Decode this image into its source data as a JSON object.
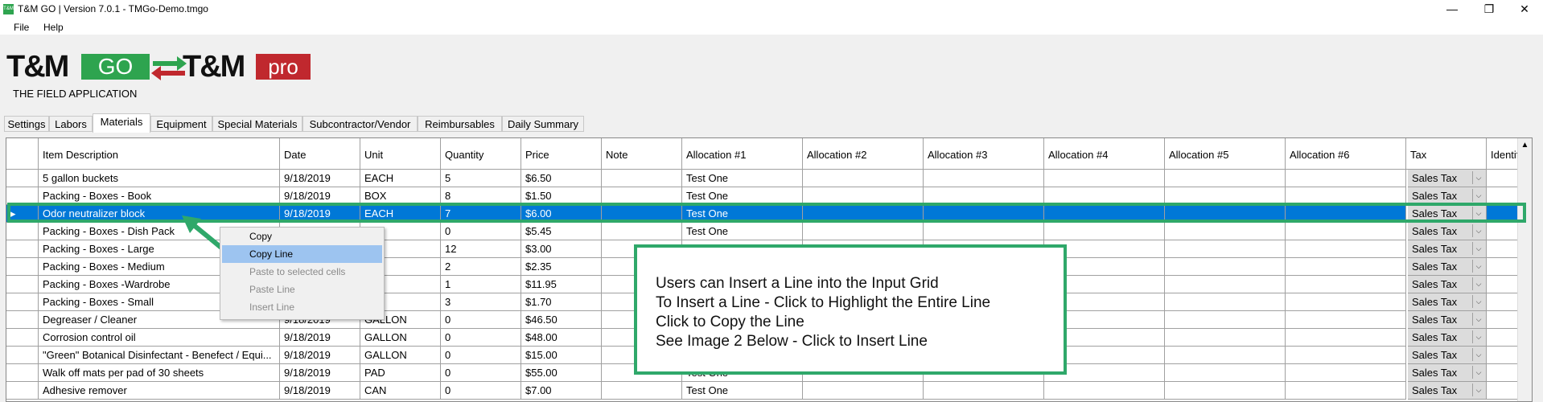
{
  "window": {
    "title": "T&M GO | Version 7.0.1 - TMGo-Demo.tmgo",
    "app_icon": "T&M",
    "controls": [
      "minimize-icon",
      "restore-icon",
      "close-icon"
    ]
  },
  "menu": {
    "items": [
      "File",
      "Help"
    ]
  },
  "logo": {
    "tm_left": "T&M",
    "go": "GO",
    "tm_right": "T&M",
    "pro": "pro",
    "subtitle": "THE FIELD APPLICATION",
    "colors": {
      "go": "#2ea44f",
      "pro": "#c0282e"
    }
  },
  "tabs": [
    {
      "label": "Settings"
    },
    {
      "label": "Labors"
    },
    {
      "label": "Materials",
      "active": true
    },
    {
      "label": "Equipment"
    },
    {
      "label": "Special Materials"
    },
    {
      "label": "Subcontractor/Vendor"
    },
    {
      "label": "Reimbursables"
    },
    {
      "label": "Daily Summary"
    }
  ],
  "grid": {
    "columns": [
      "Item Description",
      "Date",
      "Unit",
      "Quantity",
      "Price",
      "Note",
      "Allocation #1",
      "Allocation #2",
      "Allocation #3",
      "Allocation #4",
      "Allocation #5",
      "Allocation #6",
      "Tax",
      "Identifi"
    ],
    "selected_row": 2,
    "rows": [
      {
        "desc": "5 gallon buckets",
        "date": "9/18/2019",
        "unit": "EACH",
        "qty": "5",
        "price": "$6.50",
        "alloc1": "Test One",
        "tax": "Sales Tax"
      },
      {
        "desc": "Packing - Boxes - Book",
        "date": "9/18/2019",
        "unit": "BOX",
        "qty": "8",
        "price": "$1.50",
        "alloc1": "Test One",
        "tax": "Sales Tax"
      },
      {
        "desc": "Odor neutralizer block",
        "date": "9/18/2019",
        "unit": "EACH",
        "qty": "7",
        "price": "$6.00",
        "alloc1": "Test One",
        "tax": "Sales Tax"
      },
      {
        "desc": "Packing - Boxes - Dish Pack",
        "date": "",
        "unit": "",
        "qty": "0",
        "price": "$5.45",
        "alloc1": "Test One",
        "tax": "Sales Tax"
      },
      {
        "desc": "Packing - Boxes - Large",
        "date": "",
        "unit": "",
        "qty": "12",
        "price": "$3.00",
        "alloc1": "",
        "tax": "Sales Tax"
      },
      {
        "desc": "Packing - Boxes - Medium",
        "date": "",
        "unit": "",
        "qty": "2",
        "price": "$2.35",
        "alloc1": "",
        "tax": "Sales Tax"
      },
      {
        "desc": "Packing - Boxes -Wardrobe",
        "date": "",
        "unit": "",
        "qty": "1",
        "price": "$11.95",
        "alloc1": "",
        "tax": "Sales Tax"
      },
      {
        "desc": "Packing - Boxes - Small",
        "date": "",
        "unit": "",
        "qty": "3",
        "price": "$1.70",
        "alloc1": "",
        "tax": "Sales Tax"
      },
      {
        "desc": "Degreaser / Cleaner",
        "date": "9/18/2019",
        "unit": "GALLON",
        "qty": "0",
        "price": "$46.50",
        "alloc1": "",
        "tax": "Sales Tax"
      },
      {
        "desc": "Corrosion control oil",
        "date": "9/18/2019",
        "unit": "GALLON",
        "qty": "0",
        "price": "$48.00",
        "alloc1": "",
        "tax": "Sales Tax"
      },
      {
        "desc": "\"Green\" Botanical Disinfectant - Benefect / Equi...",
        "date": "9/18/2019",
        "unit": "GALLON",
        "qty": "0",
        "price": "$15.00",
        "alloc1": "",
        "tax": "Sales Tax"
      },
      {
        "desc": "Walk off mats per pad of 30 sheets",
        "date": "9/18/2019",
        "unit": "PAD",
        "qty": "0",
        "price": "$55.00",
        "alloc1": "Test One",
        "tax": "Sales Tax"
      },
      {
        "desc": "Adhesive remover",
        "date": "9/18/2019",
        "unit": "CAN",
        "qty": "0",
        "price": "$7.00",
        "alloc1": "Test One",
        "tax": "Sales Tax"
      }
    ]
  },
  "context_menu": {
    "items": [
      {
        "label": "Copy",
        "enabled": true
      },
      {
        "label": "Copy Line",
        "enabled": true,
        "hover": true
      },
      {
        "label": "Paste to selected cells",
        "enabled": false
      },
      {
        "label": "Paste Line",
        "enabled": false
      },
      {
        "label": "Insert Line",
        "enabled": false
      }
    ]
  },
  "callout": {
    "lines": [
      "Users can Insert a Line into the Input Grid",
      "To Insert a Line - Click to Highlight the Entire Line",
      "Click to Copy the Line",
      "See Image 2 Below - Click to Insert Line"
    ],
    "border_color": "#2fa86a"
  },
  "colors": {
    "selection": "#0078d7",
    "annotation": "#2fa86a"
  }
}
